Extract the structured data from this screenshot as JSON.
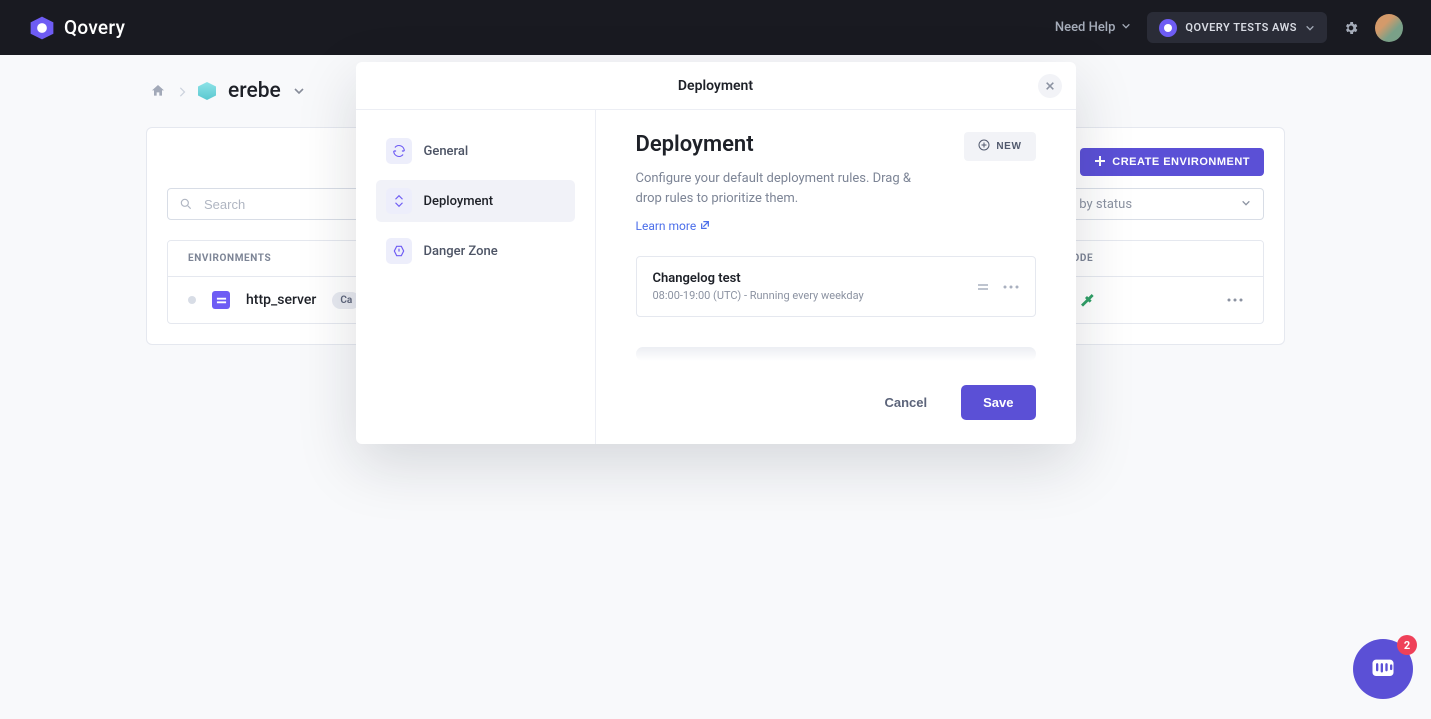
{
  "header": {
    "brand": "Qovery",
    "need_help": "Need Help",
    "org_name": "QOVERY TESTS AWS"
  },
  "breadcrumb": {
    "project": "erebe"
  },
  "page": {
    "create_env_btn": "CREATE ENVIRONMENT",
    "search_placeholder": "Search",
    "filter_placeholder": "Filter by status"
  },
  "table": {
    "col_env": "ENVIRONMENTS",
    "col_mode": "MODE",
    "rows": [
      {
        "name": "http_server",
        "badge": "Ca"
      }
    ]
  },
  "modal": {
    "title": "Deployment",
    "side": {
      "general": "General",
      "deployment": "Deployment",
      "danger": "Danger Zone"
    },
    "heading": "Deployment",
    "new_btn": "NEW",
    "subtitle": "Configure your default deployment rules. Drag & drop rules to prioritize them.",
    "learn_more": "Learn more",
    "rule": {
      "title": "Changelog test",
      "desc": "08:00-19:00 (UTC) - Running every weekday"
    },
    "cancel": "Cancel",
    "save": "Save"
  },
  "chat": {
    "badge_count": "2"
  }
}
